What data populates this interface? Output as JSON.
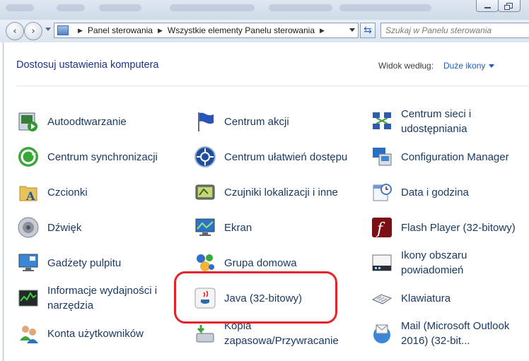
{
  "window": {
    "minimize_icon": "minimize-icon",
    "restore_icon": "restore-icon"
  },
  "nav": {
    "back_icon": "back-arrow-icon",
    "forward_icon": "forward-arrow-icon",
    "breadcrumb": [
      "Panel sterowania",
      "Wszystkie elementy Panelu sterowania"
    ],
    "refresh_icon": "refresh-icon",
    "search_placeholder": "Szukaj w Panelu sterowania"
  },
  "header": {
    "title": "Dostosuj ustawienia komputera",
    "view_by_label": "Widok według:",
    "view_by_value": "Duże ikony"
  },
  "items": [
    {
      "label": "Autoodtwarzanie",
      "icon": "autoplay-icon"
    },
    {
      "label": "Centrum akcji",
      "icon": "flag-icon"
    },
    {
      "label": "Centrum sieci i udostępniania",
      "icon": "network-icon"
    },
    {
      "label": "Centrum synchronizacji",
      "icon": "sync-icon"
    },
    {
      "label": "Centrum ułatwień dostępu",
      "icon": "accessibility-icon"
    },
    {
      "label": "Configuration Manager",
      "icon": "configuration-manager-icon"
    },
    {
      "label": "Czcionki",
      "icon": "fonts-folder-icon"
    },
    {
      "label": "Czujniki lokalizacji i inne",
      "icon": "location-sensor-icon"
    },
    {
      "label": "Data i godzina",
      "icon": "calendar-clock-icon"
    },
    {
      "label": "Dźwięk",
      "icon": "speaker-icon"
    },
    {
      "label": "Ekran",
      "icon": "monitor-icon"
    },
    {
      "label": "Flash Player (32-bitowy)",
      "icon": "flash-icon"
    },
    {
      "label": "Gadżety pulpitu",
      "icon": "gadgets-icon"
    },
    {
      "label": "Grupa domowa",
      "icon": "homegroup-icon"
    },
    {
      "label": "Ikony obszaru powiadomień",
      "icon": "notification-area-icon"
    },
    {
      "label": "Informacje wydajności i narzędzia",
      "icon": "performance-icon"
    },
    {
      "label": "Java (32-bitowy)",
      "icon": "java-icon"
    },
    {
      "label": "Klawiatura",
      "icon": "keyboard-icon"
    },
    {
      "label": "Konta użytkowników",
      "icon": "users-icon"
    },
    {
      "label": "Kopia zapasowa/Przywracanie",
      "icon": "backup-icon"
    },
    {
      "label": "Mail (Microsoft Outlook 2016) (32-bit...",
      "icon": "mail-icon"
    }
  ],
  "colors": {
    "highlight": "#e3242b",
    "title": "#1e3287",
    "link": "#1e5bb8"
  }
}
